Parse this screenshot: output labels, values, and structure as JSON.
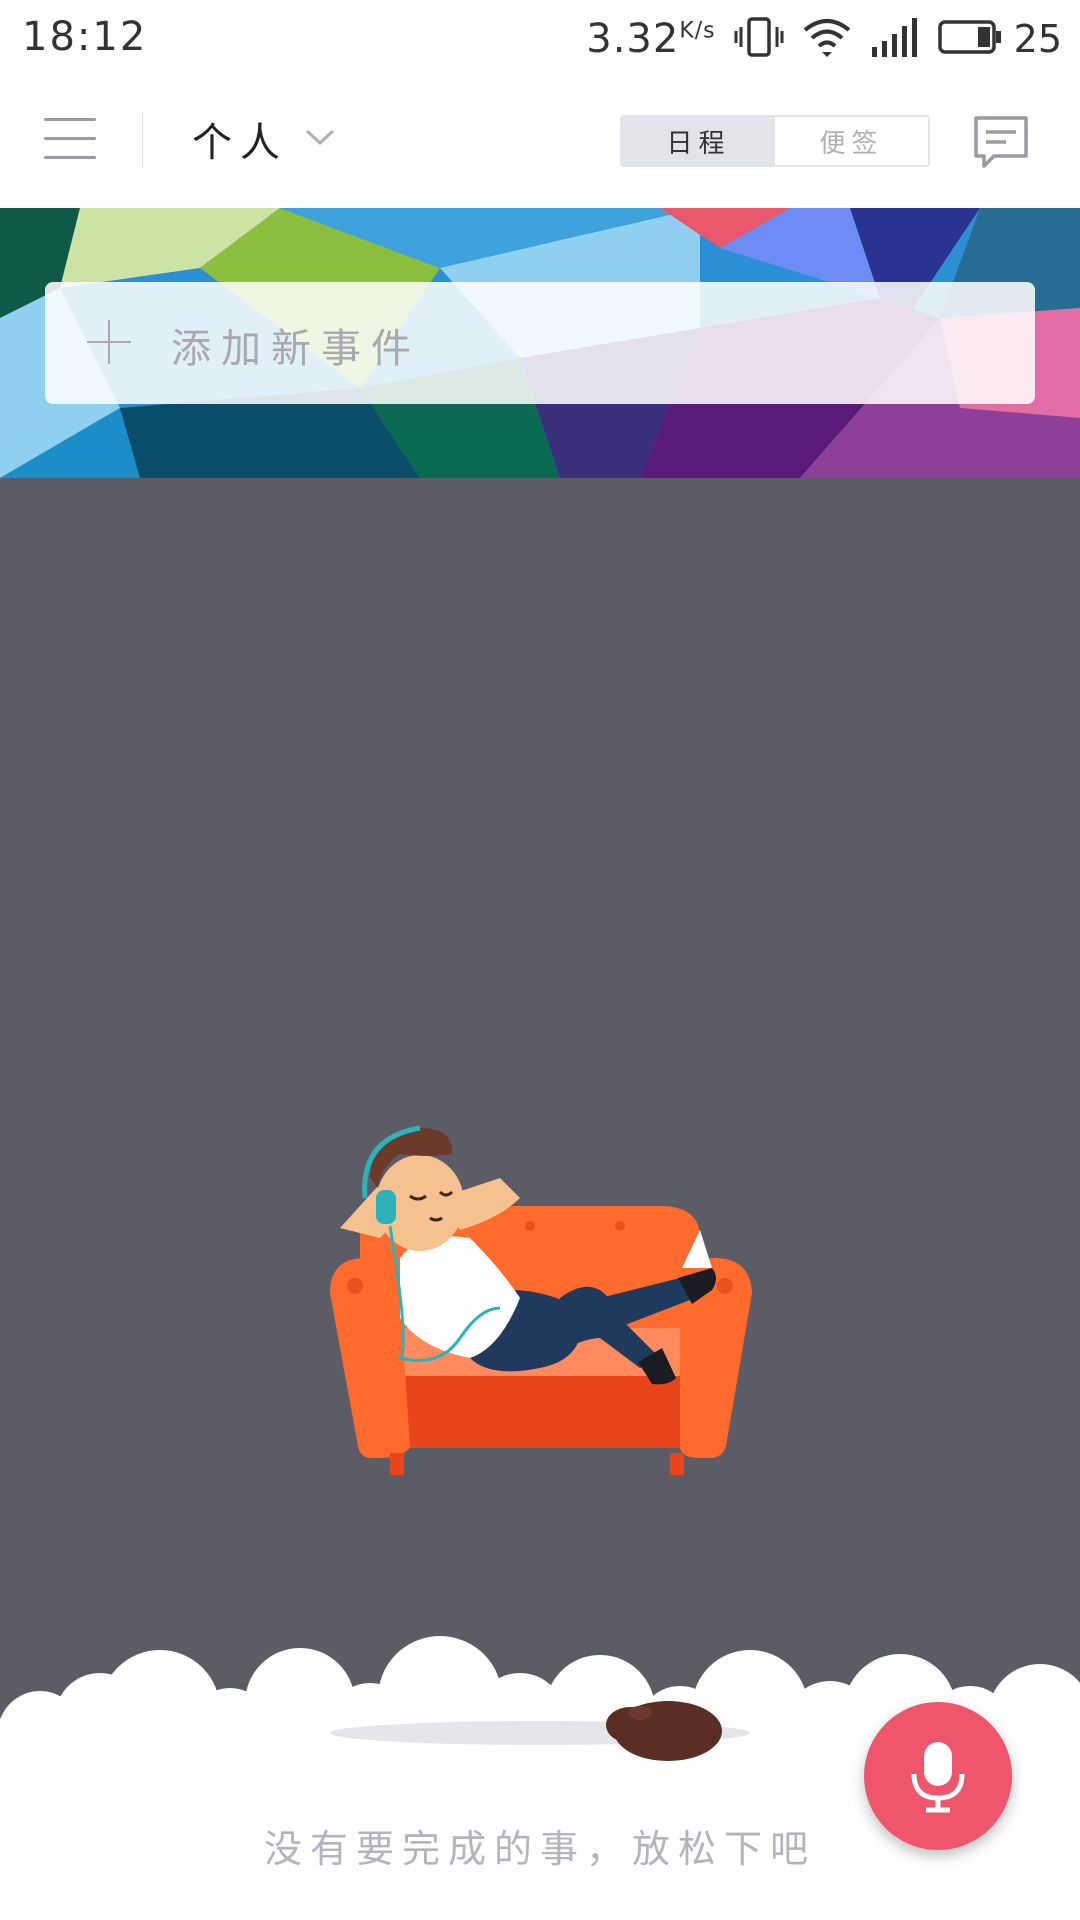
{
  "status_bar": {
    "time": "18:12",
    "net_speed": "3.32",
    "net_unit": "K/s",
    "battery_level": "25"
  },
  "toolbar": {
    "account": "个人",
    "tabs": [
      {
        "label": "日程",
        "active": true
      },
      {
        "label": "便签",
        "active": false
      }
    ]
  },
  "banner": {
    "add_placeholder": "添加新事件"
  },
  "empty_state": {
    "message": "没有要完成的事，放松下吧"
  },
  "colors": {
    "accent": "#f0566b",
    "content_bg": "#5c5c66",
    "sofa": "#ff6b2c"
  }
}
